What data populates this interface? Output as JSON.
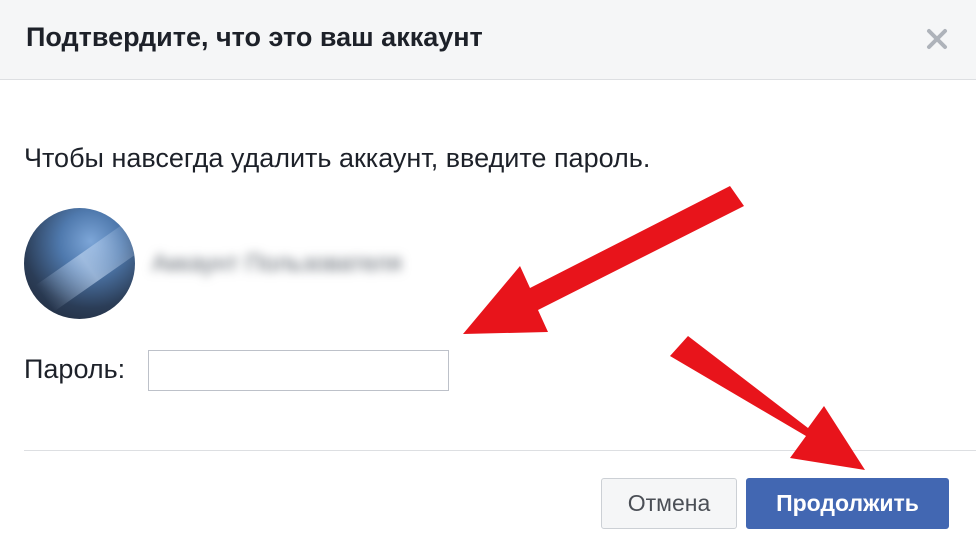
{
  "dialog": {
    "title": "Подтвердите, что это ваш аккаунт",
    "close_icon": "close-icon",
    "message": "Чтобы навсегда удалить аккаунт, введите пароль.",
    "user": {
      "name": "Аккаунт Пользователя",
      "avatar_icon": "avatar"
    },
    "password": {
      "label": "Пароль:",
      "value": "",
      "placeholder": ""
    },
    "buttons": {
      "cancel_label": "Отмена",
      "continue_label": "Продолжить"
    }
  },
  "annotations": {
    "arrow_color": "#e8141b"
  },
  "colors": {
    "header_bg": "#f5f6f7",
    "primary_button": "#4267b2",
    "text": "#1d2129"
  }
}
